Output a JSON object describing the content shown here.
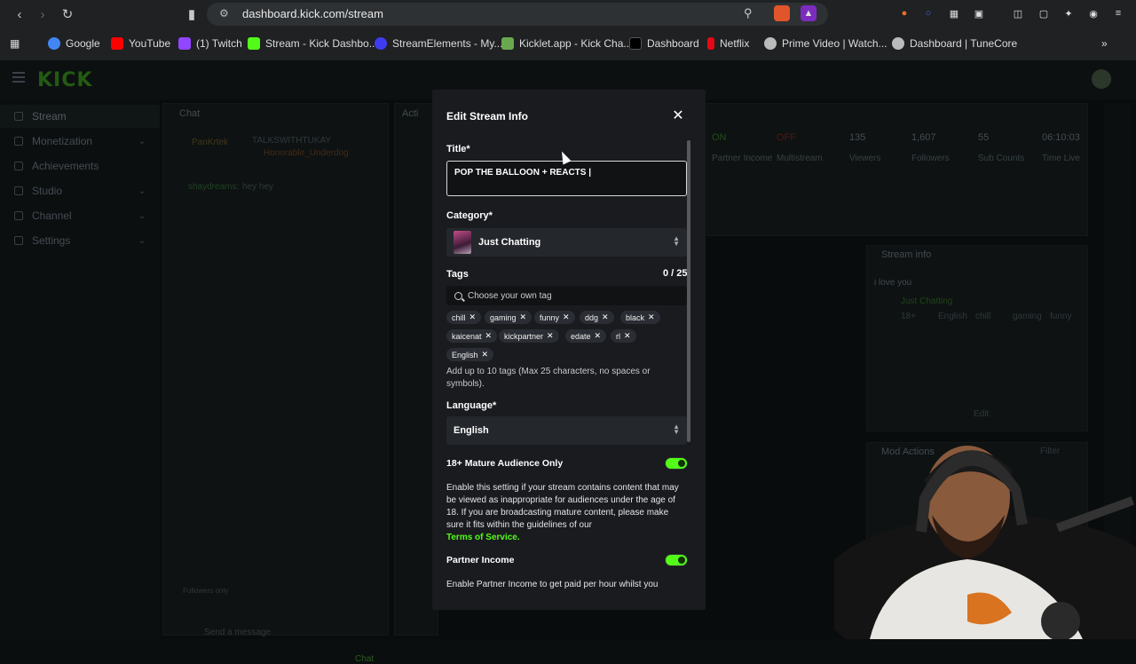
{
  "browser": {
    "url": "dashboard.kick.com/stream",
    "bookmarks": [
      {
        "label": "Google",
        "color": "#4285f4"
      },
      {
        "label": "YouTube",
        "color": "#ff0000"
      },
      {
        "label": "(1) Twitch",
        "color": "#9146ff"
      },
      {
        "label": "Stream - Kick Dashbo...",
        "color": "#53fc18"
      },
      {
        "label": "StreamElements - My...",
        "color": "#3f3cf0"
      },
      {
        "label": "Kicklet.app - Kick Cha...",
        "color": "#6aa84f"
      },
      {
        "label": "Dashboard",
        "color": "#000000"
      },
      {
        "label": "Netflix",
        "color": "#e50914"
      },
      {
        "label": "Prime Video | Watch...",
        "color": "#bbbbbb"
      },
      {
        "label": "Dashboard | TuneCore",
        "color": "#bbbbbb"
      }
    ]
  },
  "app": {
    "logo": "KICK",
    "sidebar": [
      {
        "label": "Stream",
        "active": true
      },
      {
        "label": "Monetization",
        "chev": true
      },
      {
        "label": "Achievements"
      },
      {
        "label": "Studio",
        "chev": true
      },
      {
        "label": "Channel",
        "chev": true
      },
      {
        "label": "Settings",
        "chev": true
      }
    ],
    "chat_title": "Chat",
    "chat_users": [
      "PanKrtek",
      "TALKSWITHTUKAY",
      "Honorable_Underdog"
    ],
    "chat_message": {
      "user": "shaydreams:",
      "text": "hey hey"
    },
    "chat_input_placeholder": "Send a message",
    "chat_button": "Chat",
    "followers_only": "Followers only",
    "activity_title": "Acti",
    "stats": [
      {
        "value": "ON",
        "label": "Partner Income"
      },
      {
        "value": "OFF",
        "label": "Multistream"
      },
      {
        "value": "135",
        "label": "Viewers"
      },
      {
        "value": "1,607",
        "label": "Followers"
      },
      {
        "value": "55",
        "label": "Sub Counts"
      },
      {
        "value": "06:10:03",
        "label": "Time Live"
      }
    ],
    "stream_info_title": "Stream info",
    "stream_info_text": "i love you",
    "stream_info_category": "Just Chatting",
    "stream_info_tags": [
      "18+",
      "English",
      "chill",
      "gaming",
      "funny"
    ],
    "edit_label": "Edit",
    "mod_actions_title": "Mod Actions",
    "mod_actions_partial": "Filter"
  },
  "modal": {
    "title": "Edit Stream Info",
    "title_label": "Title*",
    "title_value": "POP THE BALLOON + REACTS |",
    "category_label": "Category*",
    "category_value": "Just Chatting",
    "tags_label": "Tags",
    "tags_counter": "0 / 25",
    "tags_placeholder": "Choose your own tag",
    "tags": [
      "chill",
      "gaming",
      "funny",
      "ddg",
      "black",
      "kaicenat",
      "kickpartner",
      "edate",
      "rl",
      "English"
    ],
    "tags_help": "Add up to 10 tags (Max 25 characters, no spaces or symbols).",
    "language_label": "Language*",
    "language_value": "English",
    "mature_label": "18+ Mature Audience Only",
    "mature_on": true,
    "mature_text": "Enable this setting if your stream contains content that may be viewed as inappropriate for audiences under the age of 18. If you are broadcasting mature content, please make sure it fits within the guidelines of our",
    "tos_link": "Terms of Service.",
    "partner_label": "Partner Income",
    "partner_on": true,
    "partner_text": "Enable Partner Income to get paid per hour whilst you"
  },
  "colors": {
    "accent": "#53fc18",
    "modal_bg": "#191b1f",
    "page_bg": "#0d1112"
  }
}
